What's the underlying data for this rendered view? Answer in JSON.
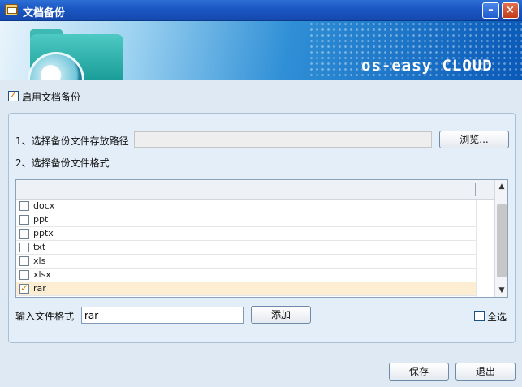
{
  "window": {
    "title": "文档备份",
    "minimize_label": "–",
    "close_label": "×"
  },
  "banner": {
    "brand": "os-easy CLOUD"
  },
  "enable": {
    "label": "启用文档备份",
    "checked": true
  },
  "step1": {
    "label": "1、选择备份文件存放路径",
    "path_value": "",
    "browse_label": "浏览..."
  },
  "step2": {
    "label": "2、选择备份文件格式"
  },
  "formats": [
    {
      "name": "docx",
      "checked": false
    },
    {
      "name": "ppt",
      "checked": false
    },
    {
      "name": "pptx",
      "checked": false
    },
    {
      "name": "txt",
      "checked": false
    },
    {
      "name": "xls",
      "checked": false
    },
    {
      "name": "xlsx",
      "checked": false
    },
    {
      "name": "rar",
      "checked": true
    }
  ],
  "input": {
    "label": "输入文件格式",
    "value": "rar",
    "add_label": "添加"
  },
  "select_all": {
    "label": "全选",
    "checked": false
  },
  "footer": {
    "save_label": "保存",
    "exit_label": "退出"
  },
  "colors": {
    "titlebar": "#1a56c2",
    "selected_row": "#fdedd3",
    "check": "#e07800"
  }
}
